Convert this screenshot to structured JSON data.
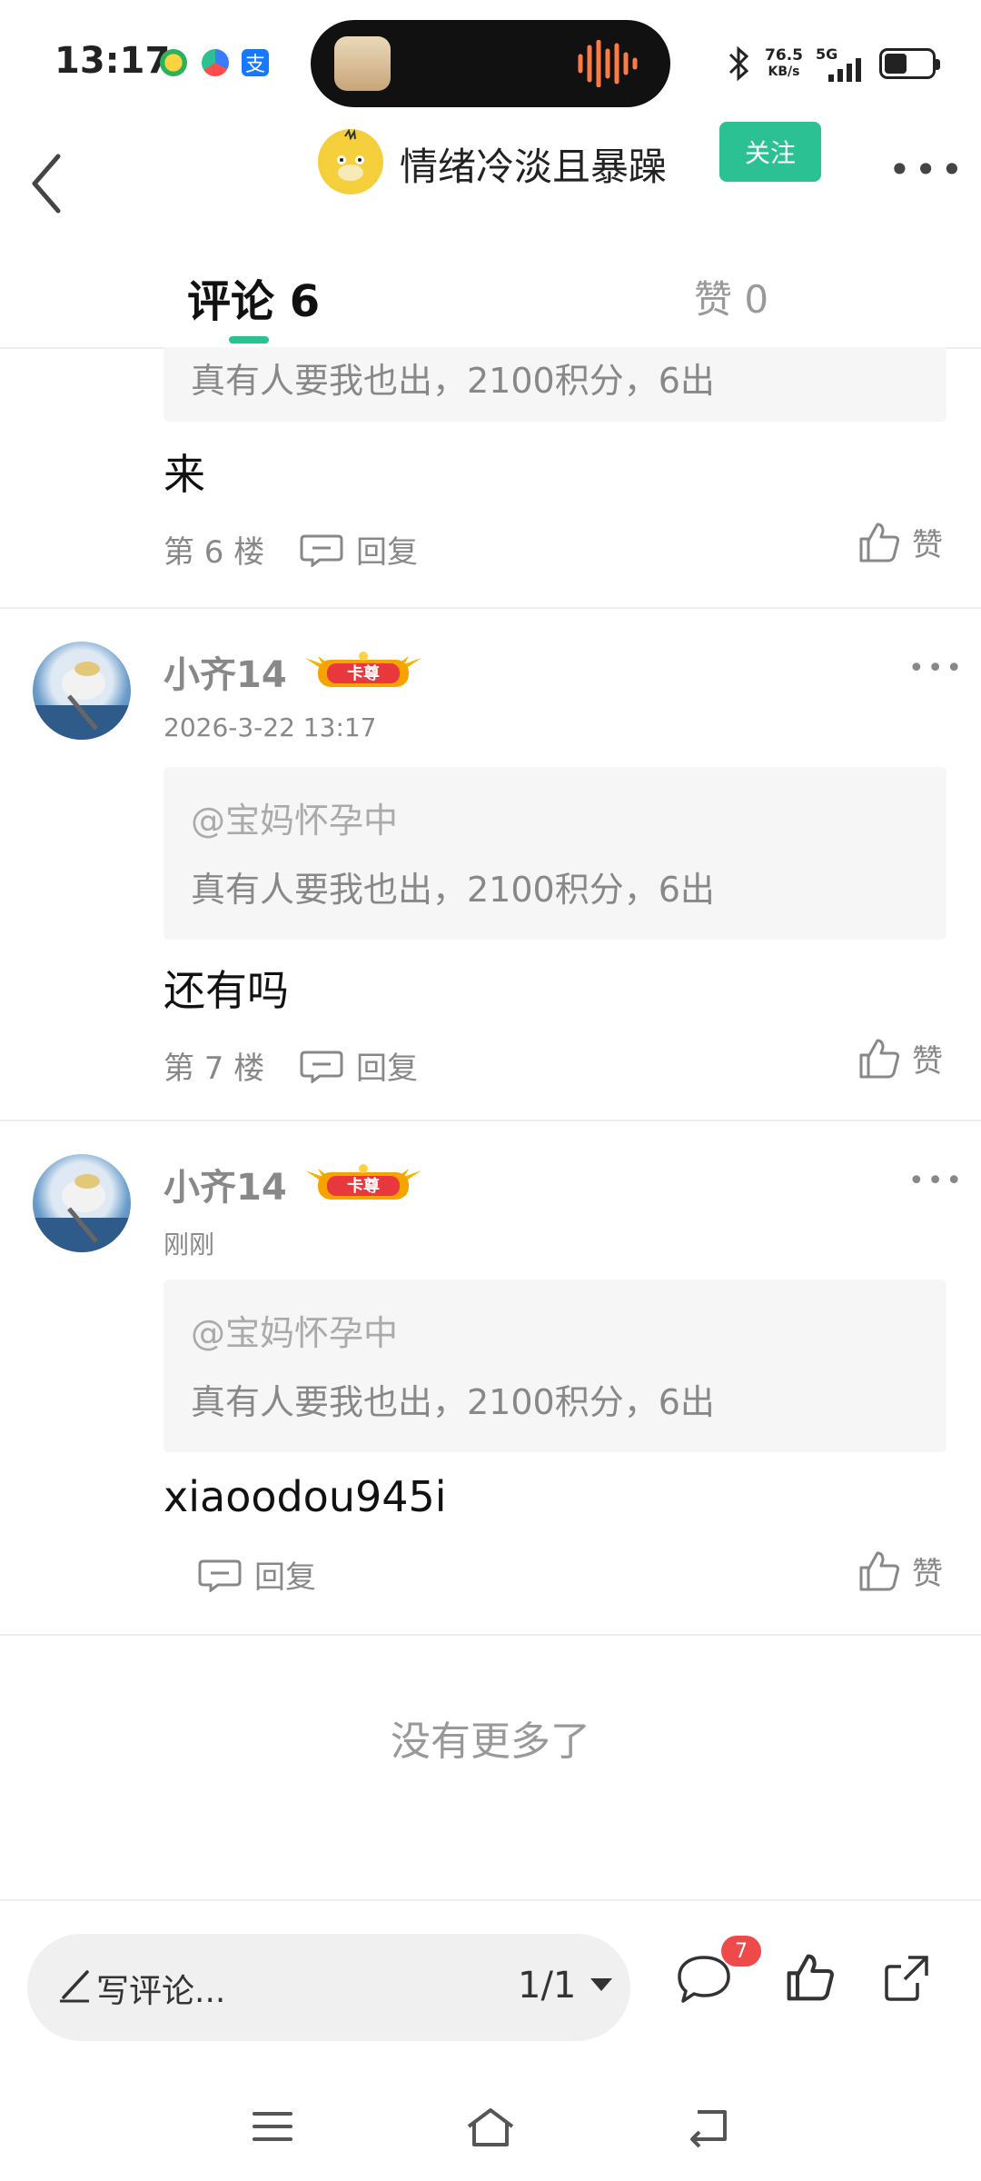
{
  "status_bar": {
    "time": "13:17",
    "net_speed_value": "76.5",
    "net_speed_unit": "KB/s",
    "network": "5G"
  },
  "nav": {
    "title": "情绪冷淡且暴躁",
    "follow_label": "关注",
    "more": "•••"
  },
  "tabs": {
    "comments": "评论 6",
    "likes": "赞 0"
  },
  "comments": [
    {
      "quote_text": "真有人要我也出，2100积分，6出",
      "content": "来",
      "floor": "第 6 楼",
      "reply_label": "回复",
      "like_label": "赞"
    },
    {
      "username": "小齐14",
      "badge": "卡尊",
      "time": "2026-3-22 13:17",
      "quote_user": "@宝妈怀孕中",
      "quote_text": "真有人要我也出，2100积分，6出",
      "content": "还有吗",
      "floor": "第 7 楼",
      "reply_label": "回复",
      "like_label": "赞"
    },
    {
      "username": "小齐14",
      "badge": "卡尊",
      "time": "刚刚",
      "quote_user": "@宝妈怀孕中",
      "quote_text": "真有人要我也出，2100积分，6出",
      "content": "xiaoodou945i",
      "reply_label": "回复",
      "like_label": "赞"
    }
  ],
  "no_more": "没有更多了",
  "bottom_bar": {
    "write_placeholder": "写评论...",
    "pager": "1/1",
    "comment_count": "7"
  },
  "colors": {
    "accent": "#2cc193",
    "badge_red": "#ef4a4a",
    "divider": "#eeeeee"
  }
}
